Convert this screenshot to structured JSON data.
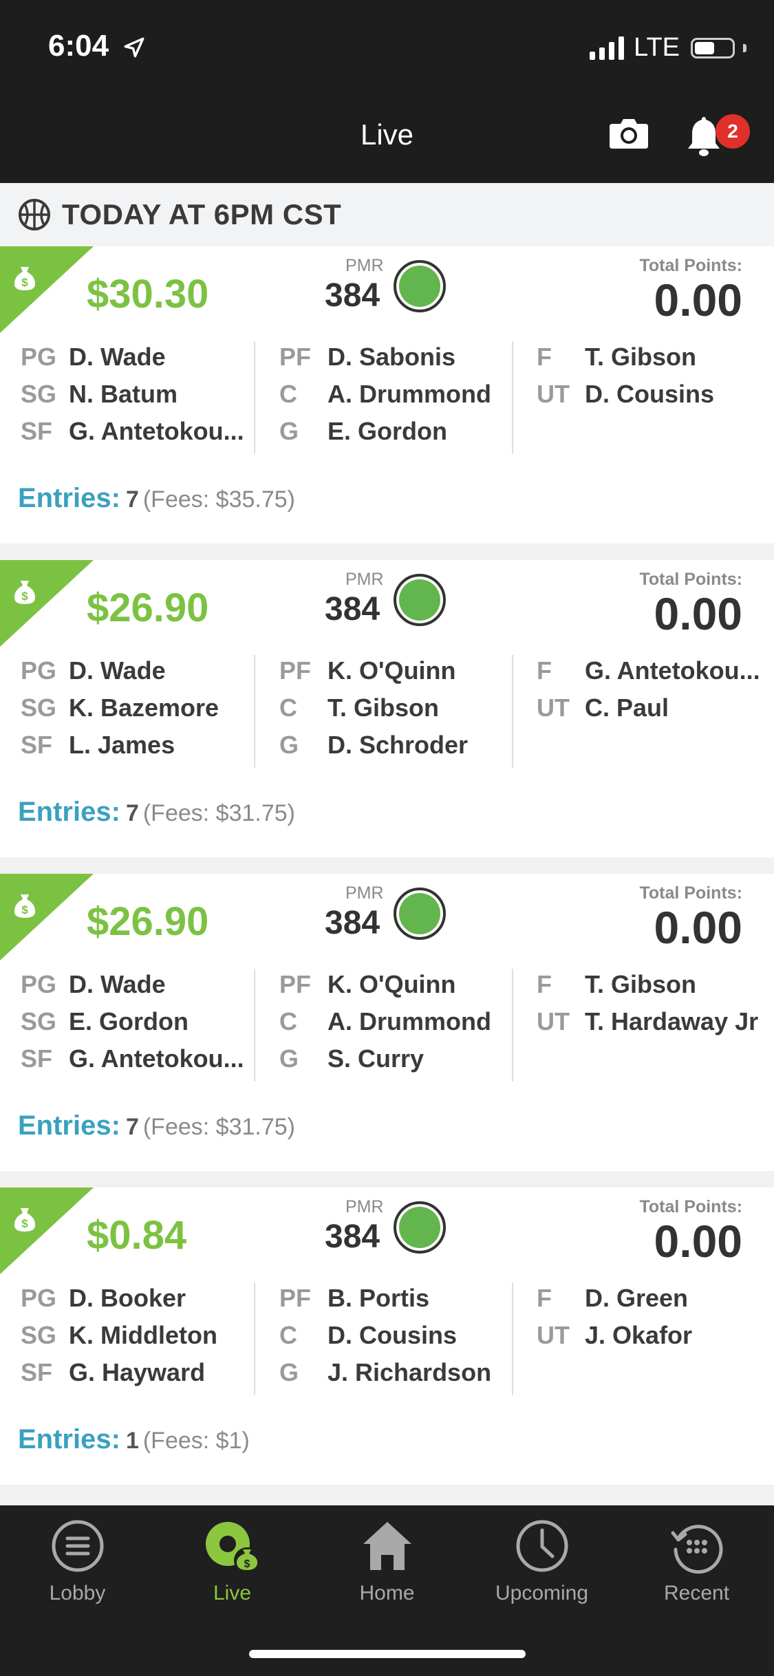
{
  "status": {
    "time": "6:04",
    "carrier": "LTE"
  },
  "header": {
    "title": "Live",
    "notification_count": "2"
  },
  "section": {
    "title": "TODAY AT 6PM CST"
  },
  "labels": {
    "pmr": "PMR",
    "total_points": "Total Points:",
    "entries": "Entries:"
  },
  "cards": [
    {
      "prize": "$30.30",
      "pmr": "384",
      "total_points": "0.00",
      "players": [
        [
          {
            "pos": "PG",
            "name": "D. Wade"
          },
          {
            "pos": "SG",
            "name": "N. Batum"
          },
          {
            "pos": "SF",
            "name": "G. Antetokou..."
          }
        ],
        [
          {
            "pos": "PF",
            "name": "D. Sabonis"
          },
          {
            "pos": "C",
            "name": "A. Drummond"
          },
          {
            "pos": "G",
            "name": "E. Gordon"
          }
        ],
        [
          {
            "pos": "F",
            "name": "T. Gibson"
          },
          {
            "pos": "UT",
            "name": "D. Cousins"
          }
        ]
      ],
      "entries": "7",
      "fees": "(Fees: $35.75)"
    },
    {
      "prize": "$26.90",
      "pmr": "384",
      "total_points": "0.00",
      "players": [
        [
          {
            "pos": "PG",
            "name": "D. Wade"
          },
          {
            "pos": "SG",
            "name": "K. Bazemore"
          },
          {
            "pos": "SF",
            "name": "L. James"
          }
        ],
        [
          {
            "pos": "PF",
            "name": "K. O'Quinn"
          },
          {
            "pos": "C",
            "name": "T. Gibson"
          },
          {
            "pos": "G",
            "name": "D. Schroder"
          }
        ],
        [
          {
            "pos": "F",
            "name": "G. Antetokou..."
          },
          {
            "pos": "UT",
            "name": "C. Paul"
          }
        ]
      ],
      "entries": "7",
      "fees": "(Fees: $31.75)"
    },
    {
      "prize": "$26.90",
      "pmr": "384",
      "total_points": "0.00",
      "players": [
        [
          {
            "pos": "PG",
            "name": "D. Wade"
          },
          {
            "pos": "SG",
            "name": "E. Gordon"
          },
          {
            "pos": "SF",
            "name": "G. Antetokou..."
          }
        ],
        [
          {
            "pos": "PF",
            "name": "K. O'Quinn"
          },
          {
            "pos": "C",
            "name": "A. Drummond"
          },
          {
            "pos": "G",
            "name": "S. Curry"
          }
        ],
        [
          {
            "pos": "F",
            "name": "T. Gibson"
          },
          {
            "pos": "UT",
            "name": "T. Hardaway Jr"
          }
        ]
      ],
      "entries": "7",
      "fees": "(Fees: $31.75)"
    },
    {
      "prize": "$0.84",
      "pmr": "384",
      "total_points": "0.00",
      "players": [
        [
          {
            "pos": "PG",
            "name": "D. Booker"
          },
          {
            "pos": "SG",
            "name": "K. Middleton"
          },
          {
            "pos": "SF",
            "name": "G. Hayward"
          }
        ],
        [
          {
            "pos": "PF",
            "name": "B. Portis"
          },
          {
            "pos": "C",
            "name": "D. Cousins"
          },
          {
            "pos": "G",
            "name": "J. Richardson"
          }
        ],
        [
          {
            "pos": "F",
            "name": "D. Green"
          },
          {
            "pos": "UT",
            "name": "J. Okafor"
          }
        ]
      ],
      "entries": "1",
      "fees": "(Fees: $1)"
    }
  ],
  "tabs": [
    {
      "label": "Lobby",
      "icon": "menu-icon",
      "active": false
    },
    {
      "label": "Live",
      "icon": "live-money-icon",
      "active": true
    },
    {
      "label": "Home",
      "icon": "home-icon",
      "active": false
    },
    {
      "label": "Upcoming",
      "icon": "clock-icon",
      "active": false
    },
    {
      "label": "Recent",
      "icon": "history-icon",
      "active": false
    }
  ],
  "colors": {
    "accent": "#7cc242",
    "entries": "#3aa1c0",
    "badge": "#e0302a",
    "bar": "#1d1d1d"
  }
}
